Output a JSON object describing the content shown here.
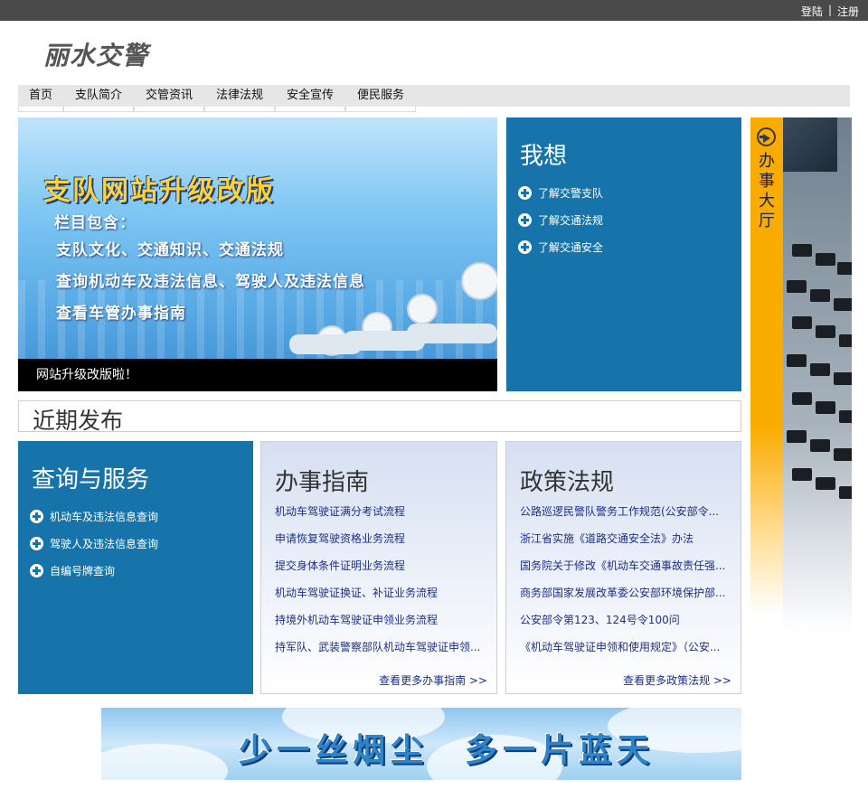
{
  "topbar": {
    "login": "登陆",
    "separator": "|",
    "register": "注册"
  },
  "logo": "丽水交警",
  "nav": [
    {
      "label": "首页"
    },
    {
      "label": "支队简介"
    },
    {
      "label": "交管资讯"
    },
    {
      "label": "法律法规"
    },
    {
      "label": "安全宣传"
    },
    {
      "label": "便民服务"
    }
  ],
  "banner": {
    "headline": "支队网站升级改版",
    "lines": [
      "栏目包含：",
      "支队文化、交通知识、交通法规",
      "查询机动车及违法信息、驾驶人及违法信息",
      "查看车管办事指南"
    ],
    "caption": "网站升级改版啦！"
  },
  "wish": {
    "title": "我想",
    "items": [
      "了解交警支队",
      "了解交通法规",
      "了解交通安全"
    ]
  },
  "recent": {
    "title": "近期发布"
  },
  "query": {
    "title": "查询与服务",
    "items": [
      "机动车及违法信息查询",
      "驾驶人及违法信息查询",
      "自编号牌查询"
    ]
  },
  "guide": {
    "title": "办事指南",
    "items": [
      "机动车驾驶证满分考试流程",
      "申请恢复驾驶资格业务流程",
      "提交身体条件证明业务流程",
      "机动车驾驶证换证、补证业务流程",
      "持境外机动车驾驶证申领业务流程",
      "持军队、武装警察部队机动车驾驶证申领..."
    ],
    "more": "查看更多办事指南 >>"
  },
  "policy": {
    "title": "政策法规",
    "items": [
      "公路巡逻民警队警务工作规范(公安部令...",
      "浙江省实施《道路交通安全法》办法",
      "国务院关于修改《机动车交通事故责任强...",
      "商务部国家发展改革委公安部环境保护部...",
      "公安部令第123、124号令100问",
      "《机动车驾驶证申领和使用规定》（公安..."
    ],
    "more": "查看更多政策法规 >>"
  },
  "hall": {
    "title": "办事大厅",
    "icon": "arrow-right-circle-icon"
  },
  "slogan": {
    "part1": "少一丝烟尘",
    "part2": "多一片蓝天"
  },
  "colors": {
    "panel_blue": "#1774aa",
    "hall_orange": "#f9ab00",
    "topbar": "#4a4a4a"
  }
}
